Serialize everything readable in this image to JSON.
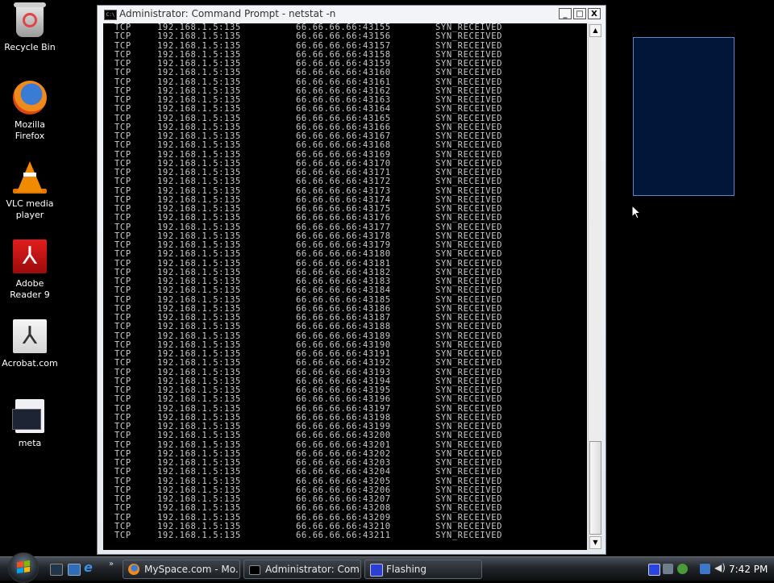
{
  "desktop": {
    "icons": [
      {
        "label": "Recycle Bin",
        "icon": "recycle-bin-icon"
      },
      {
        "label": "Mozilla Firefox",
        "icon": "firefox-icon"
      },
      {
        "label": "VLC media player",
        "icon": "vlc-cone-icon"
      },
      {
        "label": "Adobe Reader 9",
        "icon": "adobe-reader-icon"
      },
      {
        "label": "Acrobat.com",
        "icon": "acrobat-icon"
      },
      {
        "label": "meta",
        "icon": "file-icon"
      }
    ]
  },
  "cmd_window": {
    "title": "Administrator: Command Prompt - netstat  -n",
    "icon_text": "C:\\",
    "buttons": {
      "minimize": "_",
      "maximize": "□",
      "close": "X"
    },
    "rows": [
      [
        "TCP",
        "192.168.1.5:135",
        "66.66.66.66:43155",
        "SYN_RECEIVED"
      ],
      [
        "TCP",
        "192.168.1.5:135",
        "66.66.66.66:43156",
        "SYN_RECEIVED"
      ],
      [
        "TCP",
        "192.168.1.5:135",
        "66.66.66.66:43157",
        "SYN_RECEIVED"
      ],
      [
        "TCP",
        "192.168.1.5:135",
        "66.66.66.66:43158",
        "SYN_RECEIVED"
      ],
      [
        "TCP",
        "192.168.1.5:135",
        "66.66.66.66:43159",
        "SYN_RECEIVED"
      ],
      [
        "TCP",
        "192.168.1.5:135",
        "66.66.66.66:43160",
        "SYN_RECEIVED"
      ],
      [
        "TCP",
        "192.168.1.5:135",
        "66.66.66.66:43161",
        "SYN_RECEIVED"
      ],
      [
        "TCP",
        "192.168.1.5:135",
        "66.66.66.66:43162",
        "SYN_RECEIVED"
      ],
      [
        "TCP",
        "192.168.1.5:135",
        "66.66.66.66:43163",
        "SYN_RECEIVED"
      ],
      [
        "TCP",
        "192.168.1.5:135",
        "66.66.66.66:43164",
        "SYN_RECEIVED"
      ],
      [
        "TCP",
        "192.168.1.5:135",
        "66.66.66.66:43165",
        "SYN_RECEIVED"
      ],
      [
        "TCP",
        "192.168.1.5:135",
        "66.66.66.66:43166",
        "SYN_RECEIVED"
      ],
      [
        "TCP",
        "192.168.1.5:135",
        "66.66.66.66:43167",
        "SYN_RECEIVED"
      ],
      [
        "TCP",
        "192.168.1.5:135",
        "66.66.66.66:43168",
        "SYN_RECEIVED"
      ],
      [
        "TCP",
        "192.168.1.5:135",
        "66.66.66.66:43169",
        "SYN_RECEIVED"
      ],
      [
        "TCP",
        "192.168.1.5:135",
        "66.66.66.66:43170",
        "SYN_RECEIVED"
      ],
      [
        "TCP",
        "192.168.1.5:135",
        "66.66.66.66:43171",
        "SYN_RECEIVED"
      ],
      [
        "TCP",
        "192.168.1.5:135",
        "66.66.66.66:43172",
        "SYN_RECEIVED"
      ],
      [
        "TCP",
        "192.168.1.5:135",
        "66.66.66.66:43173",
        "SYN_RECEIVED"
      ],
      [
        "TCP",
        "192.168.1.5:135",
        "66.66.66.66:43174",
        "SYN_RECEIVED"
      ],
      [
        "TCP",
        "192.168.1.5:135",
        "66.66.66.66:43175",
        "SYN_RECEIVED"
      ],
      [
        "TCP",
        "192.168.1.5:135",
        "66.66.66.66:43176",
        "SYN_RECEIVED"
      ],
      [
        "TCP",
        "192.168.1.5:135",
        "66.66.66.66:43177",
        "SYN_RECEIVED"
      ],
      [
        "TCP",
        "192.168.1.5:135",
        "66.66.66.66:43178",
        "SYN_RECEIVED"
      ],
      [
        "TCP",
        "192.168.1.5:135",
        "66.66.66.66:43179",
        "SYN_RECEIVED"
      ],
      [
        "TCP",
        "192.168.1.5:135",
        "66.66.66.66:43180",
        "SYN_RECEIVED"
      ],
      [
        "TCP",
        "192.168.1.5:135",
        "66.66.66.66:43181",
        "SYN_RECEIVED"
      ],
      [
        "TCP",
        "192.168.1.5:135",
        "66.66.66.66:43182",
        "SYN_RECEIVED"
      ],
      [
        "TCP",
        "192.168.1.5:135",
        "66.66.66.66:43183",
        "SYN_RECEIVED"
      ],
      [
        "TCP",
        "192.168.1.5:135",
        "66.66.66.66:43184",
        "SYN_RECEIVED"
      ],
      [
        "TCP",
        "192.168.1.5:135",
        "66.66.66.66:43185",
        "SYN_RECEIVED"
      ],
      [
        "TCP",
        "192.168.1.5:135",
        "66.66.66.66:43186",
        "SYN_RECEIVED"
      ],
      [
        "TCP",
        "192.168.1.5:135",
        "66.66.66.66:43187",
        "SYN_RECEIVED"
      ],
      [
        "TCP",
        "192.168.1.5:135",
        "66.66.66.66:43188",
        "SYN_RECEIVED"
      ],
      [
        "TCP",
        "192.168.1.5:135",
        "66.66.66.66:43189",
        "SYN_RECEIVED"
      ],
      [
        "TCP",
        "192.168.1.5:135",
        "66.66.66.66:43190",
        "SYN_RECEIVED"
      ],
      [
        "TCP",
        "192.168.1.5:135",
        "66.66.66.66:43191",
        "SYN_RECEIVED"
      ],
      [
        "TCP",
        "192.168.1.5:135",
        "66.66.66.66:43192",
        "SYN_RECEIVED"
      ],
      [
        "TCP",
        "192.168.1.5:135",
        "66.66.66.66:43193",
        "SYN_RECEIVED"
      ],
      [
        "TCP",
        "192.168.1.5:135",
        "66.66.66.66:43194",
        "SYN_RECEIVED"
      ],
      [
        "TCP",
        "192.168.1.5:135",
        "66.66.66.66:43195",
        "SYN_RECEIVED"
      ],
      [
        "TCP",
        "192.168.1.5:135",
        "66.66.66.66:43196",
        "SYN_RECEIVED"
      ],
      [
        "TCP",
        "192.168.1.5:135",
        "66.66.66.66:43197",
        "SYN_RECEIVED"
      ],
      [
        "TCP",
        "192.168.1.5:135",
        "66.66.66.66:43198",
        "SYN_RECEIVED"
      ],
      [
        "TCP",
        "192.168.1.5:135",
        "66.66.66.66:43199",
        "SYN_RECEIVED"
      ],
      [
        "TCP",
        "192.168.1.5:135",
        "66.66.66.66:43200",
        "SYN_RECEIVED"
      ],
      [
        "TCP",
        "192.168.1.5:135",
        "66.66.66.66:43201",
        "SYN_RECEIVED"
      ],
      [
        "TCP",
        "192.168.1.5:135",
        "66.66.66.66:43202",
        "SYN_RECEIVED"
      ],
      [
        "TCP",
        "192.168.1.5:135",
        "66.66.66.66:43203",
        "SYN_RECEIVED"
      ],
      [
        "TCP",
        "192.168.1.5:135",
        "66.66.66.66:43204",
        "SYN_RECEIVED"
      ],
      [
        "TCP",
        "192.168.1.5:135",
        "66.66.66.66:43205",
        "SYN_RECEIVED"
      ],
      [
        "TCP",
        "192.168.1.5:135",
        "66.66.66.66:43206",
        "SYN_RECEIVED"
      ],
      [
        "TCP",
        "192.168.1.5:135",
        "66.66.66.66:43207",
        "SYN_RECEIVED"
      ],
      [
        "TCP",
        "192.168.1.5:135",
        "66.66.66.66:43208",
        "SYN_RECEIVED"
      ],
      [
        "TCP",
        "192.168.1.5:135",
        "66.66.66.66:43209",
        "SYN_RECEIVED"
      ],
      [
        "TCP",
        "192.168.1.5:135",
        "66.66.66.66:43210",
        "SYN_RECEIVED"
      ],
      [
        "TCP",
        "192.168.1.5:135",
        "66.66.66.66:43211",
        "SYN_RECEIVED"
      ]
    ],
    "scrollbar": {
      "up_arrow": "▲",
      "down_arrow": "▼",
      "position": "bottom"
    }
  },
  "flashing_window": {
    "background": "#011638",
    "border": "#5d86c4"
  },
  "taskbar": {
    "quick_launch": [
      "show-desktop",
      "switch-windows",
      "internet-explorer"
    ],
    "more_label": "»",
    "buttons": [
      {
        "label": "MySpace.com - Mo...",
        "icon": "firefox-icon"
      },
      {
        "label": "Administrator: Com...",
        "icon": "cmd-icon"
      },
      {
        "label": "Flashing",
        "icon": "app-window-icon"
      }
    ],
    "tray": {
      "clock": "7:42 PM",
      "volume_glyph": "🔊"
    }
  }
}
